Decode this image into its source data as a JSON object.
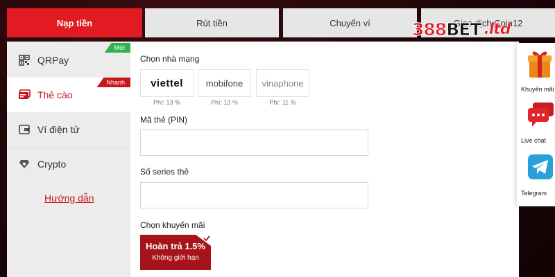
{
  "tabs": [
    {
      "label": "Nạp tiền",
      "active": true
    },
    {
      "label": "Rút tiền"
    },
    {
      "label": "Chuyển ví"
    },
    {
      "label": "Giao dịch Coin12"
    }
  ],
  "logo": {
    "part1": "388",
    "part2": "BET",
    "tld": ".ltd"
  },
  "sidebar": {
    "items": [
      {
        "label": "QRPay",
        "badge": "Mới",
        "icon": "qr-code-icon"
      },
      {
        "label": "Thẻ cào",
        "badge": "Nhanh",
        "icon": "card-icon",
        "active": true
      },
      {
        "label": "Ví điện tử",
        "icon": "wallet-icon"
      },
      {
        "label": "Crypto",
        "icon": "diamond-icon"
      }
    ],
    "guide": "Hướng dẫn"
  },
  "form": {
    "network_label": "Chọn nhà mạng",
    "carriers": [
      {
        "name": "viettel",
        "fee": "Phí: 13 %"
      },
      {
        "name": "mobifone",
        "fee": "Phí: 13 %"
      },
      {
        "name": "vinaphone",
        "fee": "Phí: 11 %"
      }
    ],
    "pin_label": "Mã thẻ (PIN)",
    "pin_value": "",
    "serial_label": "Số series thẻ",
    "serial_value": "",
    "promo_label": "Chọn khuyến mãi",
    "promo": {
      "title": "Hoàn trả 1.5%",
      "subtitle": "Không giới hạn"
    }
  },
  "float_panel": {
    "items": [
      {
        "label": "Khuyến mãi",
        "icon": "gift-icon"
      },
      {
        "label": "Live chat",
        "icon": "chat-icon"
      },
      {
        "label": "Telegram",
        "icon": "telegram-icon"
      }
    ]
  },
  "colors": {
    "accent": "#e21a22",
    "badge_new": "#2fb34a",
    "promo_bg": "#a5141a"
  }
}
